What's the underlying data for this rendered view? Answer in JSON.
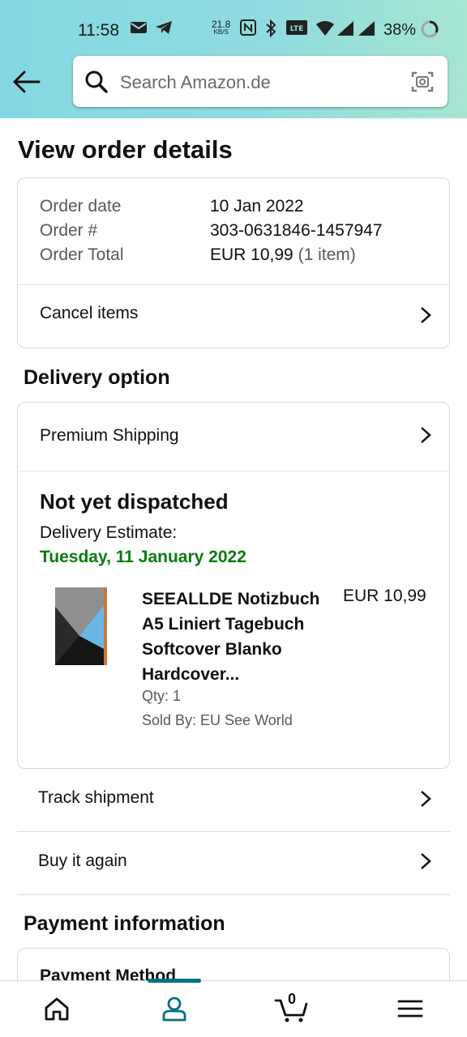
{
  "status_bar": {
    "time": "11:58",
    "speed_value": "21.8",
    "speed_unit": "KB/S",
    "battery": "38%"
  },
  "search": {
    "placeholder": "Search Amazon.de"
  },
  "page": {
    "title": "View order details"
  },
  "order_summary": {
    "date_label": "Order date",
    "date_value": "10 Jan 2022",
    "number_label": "Order #",
    "number_value": "303-0631846-1457947",
    "total_label": "Order Total",
    "total_value": "EUR 10,99",
    "total_items": "(1 item)",
    "cancel_label": "Cancel items"
  },
  "delivery": {
    "section_title": "Delivery option",
    "option_label": "Premium Shipping",
    "status": "Not yet dispatched",
    "estimate_label": "Delivery Estimate:",
    "estimate_date": "Tuesday, 11 January 2022",
    "product": {
      "name_lines": [
        "SEEALLDE Notizbuch",
        "A5 Liniert Tagebuch",
        "Softcover Blanko",
        "Hardcover..."
      ],
      "price": "EUR 10,99",
      "qty": "Qty: 1",
      "sold_by": "Sold By: EU See World"
    }
  },
  "actions": {
    "track": "Track shipment",
    "buy_again": "Buy it again"
  },
  "payment": {
    "section_title": "Payment information",
    "method_label": "Payment Method"
  },
  "bottom_nav": {
    "cart_count": "0",
    "active_tab": "account"
  },
  "colors": {
    "header_start": "#84d8e3",
    "header_end": "#a6e5d2",
    "delivery_green": "#067d0f",
    "nav_accent": "#007185"
  }
}
